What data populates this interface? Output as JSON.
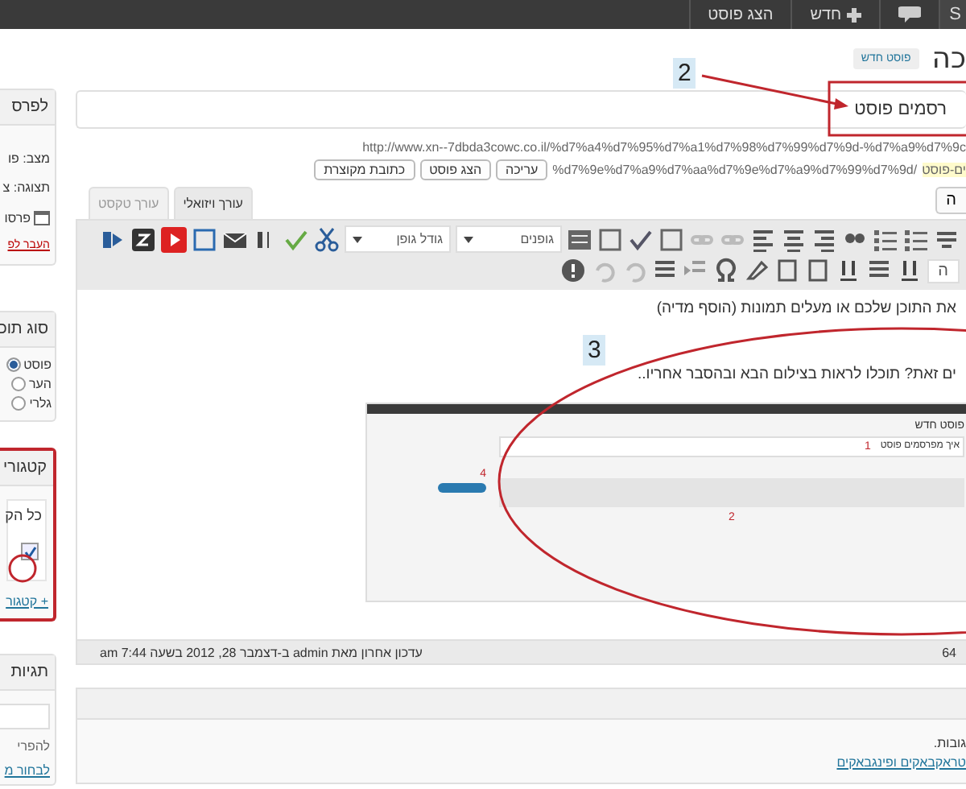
{
  "admin_bar": {
    "items": [
      {
        "kind": "site",
        "label": "S"
      },
      {
        "kind": "comments"
      },
      {
        "kind": "new",
        "label": "חדש"
      },
      {
        "kind": "link",
        "label": "הצג פוסט"
      }
    ]
  },
  "header": {
    "heading": "כה",
    "new_post_button": "פוסט חדש"
  },
  "title_field": {
    "value": "רסמים פוסט"
  },
  "permalink": {
    "url": "http://www.xn--7dbda3cowc.co.il/%d7%a4%d7%95%d7%a1%d7%98%d7%99%d7%9d-%d7%a9%d7%9c",
    "slug": "ים-פוסט",
    "path": "%d7%9e%d7%a9%d7%aa%d7%9e%d7%a9%d7%99%d7%9d/",
    "buttons": [
      "עריכה",
      "הצג פוסט",
      "כתובת מקוצרת"
    ]
  },
  "editor": {
    "media_button": "ה",
    "tabs": [
      {
        "label": "עורך ויזואלי",
        "selected": true
      },
      {
        "label": "עורך טקסט",
        "selected": false
      }
    ],
    "format_select": "ה",
    "font_family": "גופנים",
    "font_size": "גודל גופן",
    "paragraphs": [
      "את התוכן שלכם או מעלים תמונות (הוסף מדיה)",
      "ים זאת? תוכלו לראות בצילום הבא ובהסבר אחריו.."
    ],
    "embedded_screenshot": {
      "title": "פוסט חדש",
      "post_title": "איך מפרסמים פוסט",
      "marks": [
        "1",
        "2",
        "4"
      ]
    },
    "status": "עדכון אחרון מאת admin ב-דצמבר 28, 2012 בשעה 7:44 am",
    "word_count": "64"
  },
  "annotations": [
    {
      "label": "2"
    },
    {
      "label": "3"
    }
  ],
  "sidebar": {
    "publish": {
      "title": "לפרס",
      "lines": [
        "מצב: פו",
        "תצוגה: צ",
        "פרסו"
      ],
      "link": "העבר לפ"
    },
    "format": {
      "title": "סוג תוכ",
      "options": [
        {
          "label": "פוסט",
          "selected": true
        },
        {
          "label": "הער",
          "selected": false
        },
        {
          "label": "גלרי",
          "selected": false
        }
      ]
    },
    "categories": {
      "title": "קטגורי",
      "tab": "כל הק",
      "items": [
        {
          "checked": true
        }
      ],
      "add_link": "+ קטגור"
    },
    "tags": {
      "title": "תגיות",
      "hint": "להפרי",
      "link": "לבחור מ"
    }
  },
  "discussion": {
    "text": "גובות.",
    "link": "טראקבאקים ופינגבאקים"
  }
}
